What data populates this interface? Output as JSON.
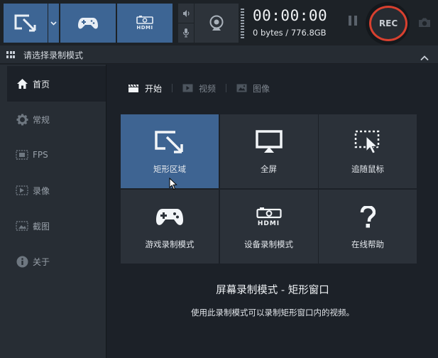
{
  "toolbar": {
    "modes": [
      {
        "name": "rectangle-mode",
        "icon": "rectangle-select-icon"
      },
      {
        "name": "game-mode",
        "icon": "gamepad-icon"
      },
      {
        "name": "device-mode",
        "icon": "hdmi-icon",
        "label": "HDMI"
      }
    ],
    "timer": "00:00:00",
    "storage": "0 bytes / 776.8GB",
    "rec_label": "REC",
    "accent_color": "#3d6594",
    "rec_ring_color": "#d8402f"
  },
  "panel": {
    "title": "请选择录制模式"
  },
  "sidebar": {
    "items": [
      {
        "label": "首页",
        "icon": "home-icon",
        "active": true
      },
      {
        "label": "常规",
        "icon": "gear-icon"
      },
      {
        "label": "FPS",
        "icon": "fps-icon"
      },
      {
        "label": "录像",
        "icon": "video-icon"
      },
      {
        "label": "截图",
        "icon": "image-icon"
      },
      {
        "label": "关于",
        "icon": "info-icon"
      }
    ]
  },
  "tabs": [
    {
      "label": "开始",
      "icon": "clapper-icon",
      "active": true
    },
    {
      "label": "视频",
      "icon": "play-icon"
    },
    {
      "label": "图像",
      "icon": "picture-icon"
    }
  ],
  "modes": [
    {
      "label": "矩形区域",
      "icon": "rectangle-select-icon",
      "selected": true
    },
    {
      "label": "全屏",
      "icon": "monitor-icon"
    },
    {
      "label": "追随鼠标",
      "icon": "follow-mouse-icon"
    },
    {
      "label": "游戏录制模式",
      "icon": "gamepad-icon"
    },
    {
      "label": "设备录制模式",
      "icon": "hdmi-icon",
      "sublabel": "HDMI"
    },
    {
      "label": "在线帮助",
      "icon": "question-icon"
    }
  ],
  "description": {
    "title": "屏幕录制模式 - 矩形窗口",
    "text": "使用此录制模式可以录制矩形窗口内的视频。"
  }
}
